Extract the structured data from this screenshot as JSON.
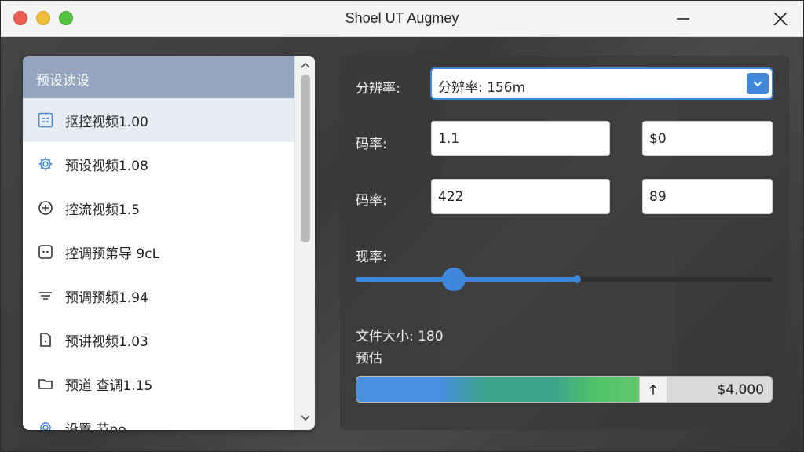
{
  "window": {
    "title": "Shoel UT Augmey"
  },
  "sidebar": {
    "header": "预设读设",
    "items": [
      {
        "label": "抠控视频1.00",
        "icon": "video-icon",
        "selected": true
      },
      {
        "label": "预设视频1.08",
        "icon": "gear-icon",
        "selected": false
      },
      {
        "label": "控流视频1.5",
        "icon": "plus-circle-icon",
        "selected": false
      },
      {
        "label": "控调预第导 9cL",
        "icon": "dots-box-icon",
        "selected": false
      },
      {
        "label": "预调预频1.94",
        "icon": "filter-icon",
        "selected": false
      },
      {
        "label": "预讲视频1.03",
        "icon": "file-icon",
        "selected": false
      },
      {
        "label": "预道 查调1.15",
        "icon": "folder-icon",
        "selected": false
      },
      {
        "label": "设置 节po",
        "icon": "gear-icon",
        "selected": false
      }
    ]
  },
  "settings": {
    "resolution_label": "分辨率:",
    "resolution_value": "分辨率: 156m",
    "bitrate1_label": "码率:",
    "bitrate1_value": "1.1",
    "bitrate1_extra": "$0",
    "bitrate2_label": "码率:",
    "bitrate2_value": "422",
    "bitrate2_extra": "89",
    "rate_label": "现率:",
    "rate_slider_fraction": 0.235,
    "rate_slider_range_end_fraction": 0.532,
    "filesize_label": "文件大小: 180",
    "estimate_label": "预估",
    "filesize_value": "$4,000",
    "filesize_fill_fraction": 0.68
  },
  "colors": {
    "accent": "#3f87db",
    "header_bg": "#94a5bd",
    "selected_bg": "#e7ebf2"
  }
}
